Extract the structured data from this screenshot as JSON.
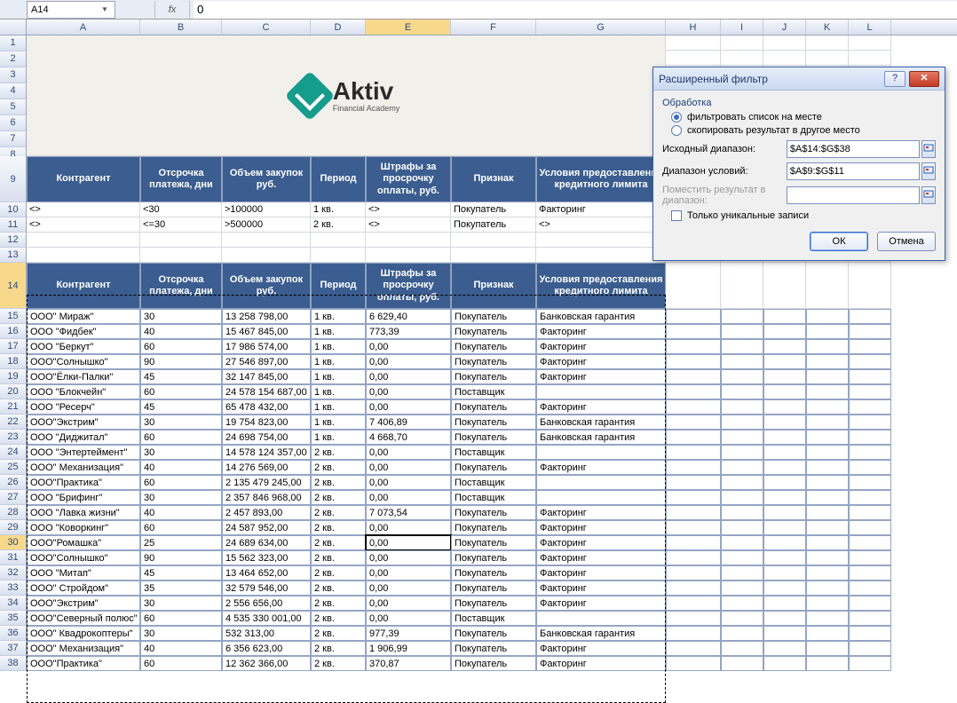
{
  "formula_bar": {
    "name_box": "A14",
    "formula_value": "0"
  },
  "columns": [
    {
      "label": "A",
      "w": 128
    },
    {
      "label": "B",
      "w": 92
    },
    {
      "label": "C",
      "w": 100
    },
    {
      "label": "D",
      "w": 62
    },
    {
      "label": "E",
      "w": 96
    },
    {
      "label": "F",
      "w": 96
    },
    {
      "label": "G",
      "w": 146
    },
    {
      "label": "H",
      "w": 62
    },
    {
      "label": "I",
      "w": 48
    },
    {
      "label": "J",
      "w": 48
    },
    {
      "label": "K",
      "w": 48
    },
    {
      "label": "L",
      "w": 48
    }
  ],
  "logo": {
    "name": "Aktiv",
    "subtitle": "Financial Academy"
  },
  "headers": [
    "Контрагент",
    "Отсрочка платежа, дни",
    "Объем закупок руб.",
    "Период",
    "Штрафы за просрочку оплаты, руб.",
    "Признак",
    "Условия предоставления кредитного лимита"
  ],
  "criteria_rows": [
    [
      "<>",
      "<30",
      ">100000",
      "1 кв.",
      "<>",
      "Покупатель",
      "Факторинг"
    ],
    [
      "<>",
      "<=30",
      ">500000",
      "2 кв.",
      "<>",
      "Покупатель",
      "<>"
    ]
  ],
  "data_rows": [
    {
      "n": 15,
      "r": [
        "ООО\" Мираж\"",
        "30",
        "13 258 798,00",
        "1 кв.",
        "6 629,40",
        "Покупатель",
        "Банковская гарантия"
      ]
    },
    {
      "n": 16,
      "r": [
        "ООО \"Фидбек\"",
        "40",
        "15 467 845,00",
        "1 кв.",
        "773,39",
        "Покупатель",
        "Факторинг"
      ]
    },
    {
      "n": 17,
      "r": [
        "ООО \"Беркут\"",
        "60",
        "17 986 574,00",
        "1 кв.",
        "0,00",
        "Покупатель",
        "Факторинг"
      ]
    },
    {
      "n": 18,
      "r": [
        "ООО\"Солнышко\"",
        "90",
        "27 546 897,00",
        "1 кв.",
        "0,00",
        "Покупатель",
        "Факторинг"
      ]
    },
    {
      "n": 19,
      "r": [
        "ООО\"Ёлки-Палки\"",
        "45",
        "32 147 845,00",
        "1 кв.",
        "0,00",
        "Покупатель",
        "Факторинг"
      ]
    },
    {
      "n": 20,
      "r": [
        "ООО \"Блокчейн\"",
        "60",
        "24 578 154 687,00",
        "1 кв.",
        "0,00",
        "Поставщик",
        ""
      ]
    },
    {
      "n": 21,
      "r": [
        "ООО \"Ресерч\"",
        "45",
        "65 478 432,00",
        "1 кв.",
        "0,00",
        "Покупатель",
        "Факторинг"
      ]
    },
    {
      "n": 22,
      "r": [
        "ООО\"Экстрим\"",
        "30",
        "19 754 823,00",
        "1 кв.",
        "7 406,89",
        "Покупатель",
        "Банковская гарантия"
      ]
    },
    {
      "n": 23,
      "r": [
        "ООО \"Диджитал\"",
        "60",
        "24 698 754,00",
        "1 кв.",
        "4 668,70",
        "Покупатель",
        "Банковская гарантия"
      ]
    },
    {
      "n": 24,
      "r": [
        "ООО \"Энтертеймент\"",
        "30",
        "14 578 124 357,00",
        "2 кв.",
        "0,00",
        "Поставщик",
        ""
      ]
    },
    {
      "n": 25,
      "r": [
        "ООО\" Механизация\"",
        "40",
        "14 276 569,00",
        "2 кв.",
        "0,00",
        "Покупатель",
        "Факторинг"
      ]
    },
    {
      "n": 26,
      "r": [
        "ООО\"Практика\"",
        "60",
        "2 135 479 245,00",
        "2 кв.",
        "0,00",
        "Поставщик",
        ""
      ]
    },
    {
      "n": 27,
      "r": [
        "ООО \"Брифинг\"",
        "30",
        "2 357 846 968,00",
        "2 кв.",
        "0,00",
        "Поставщик",
        ""
      ]
    },
    {
      "n": 28,
      "r": [
        "ООО \"Лавка жизни\"",
        "40",
        "2 457 893,00",
        "2 кв.",
        "7 073,54",
        "Покупатель",
        "Факторинг"
      ]
    },
    {
      "n": 29,
      "r": [
        "ООО \"Коворкинг\"",
        "60",
        "24 587 952,00",
        "2 кв.",
        "0,00",
        "Покупатель",
        "Факторинг"
      ]
    },
    {
      "n": 30,
      "r": [
        "ООО\"Ромашка\"",
        "25",
        "24 689 634,00",
        "2 кв.",
        "0,00",
        "Покупатель",
        "Факторинг"
      ]
    },
    {
      "n": 31,
      "r": [
        "ООО\"Солнышко\"",
        "90",
        "15 562 323,00",
        "2 кв.",
        "0,00",
        "Покупатель",
        "Факторинг"
      ]
    },
    {
      "n": 32,
      "r": [
        "ООО \"Митап\"",
        "45",
        "13 464 652,00",
        "2 кв.",
        "0,00",
        "Покупатель",
        "Факторинг"
      ]
    },
    {
      "n": 33,
      "r": [
        "ООО\" Стройдом\"",
        "35",
        "32 579 546,00",
        "2 кв.",
        "0,00",
        "Покупатель",
        "Факторинг"
      ]
    },
    {
      "n": 34,
      "r": [
        "ООО\"Экстрим\"",
        "30",
        "2 556 656,00",
        "2 кв.",
        "0,00",
        "Покупатель",
        "Факторинг"
      ]
    },
    {
      "n": 35,
      "r": [
        "ООО\"Северный полюс\"",
        "60",
        "4 535 330 001,00",
        "2 кв.",
        "0,00",
        "Поставщик",
        ""
      ]
    },
    {
      "n": 36,
      "r": [
        "ООО\" Квадрокоптеры\"",
        "30",
        "532 313,00",
        "2 кв.",
        "977,39",
        "Покупатель",
        "Банковская гарантия"
      ]
    },
    {
      "n": 37,
      "r": [
        "ООО\" Механизация\"",
        "40",
        "6 356 623,00",
        "2 кв.",
        "1 906,99",
        "Покупатель",
        "Факторинг"
      ]
    },
    {
      "n": 38,
      "r": [
        "ООО\"Практика\"",
        "60",
        "12 362 366,00",
        "2 кв.",
        "370,87",
        "Покупатель",
        "Факторинг"
      ]
    }
  ],
  "dialog": {
    "title": "Расширенный фильтр",
    "section_label": "Обработка",
    "radio1": "фильтровать список на месте",
    "radio2": "скопировать результат в другое место",
    "field1_label": "Исходный диапазон:",
    "field1_value": "$A$14:$G$38",
    "field2_label": "Диапазон условий:",
    "field2_value": "$A$9:$G$11",
    "field3_label": "Поместить результат в диапазон:",
    "field3_value": "",
    "check_label": "Только уникальные записи",
    "ok": "ОК",
    "cancel": "Отмена",
    "help": "?"
  },
  "row_labels_empty": [
    1,
    2,
    3,
    4,
    5,
    6,
    7,
    8
  ],
  "row_label_9": 9,
  "row_label_10": 10,
  "row_label_11": 11,
  "row_label_12": 12,
  "row_label_13": 13,
  "row_label_14": 14
}
